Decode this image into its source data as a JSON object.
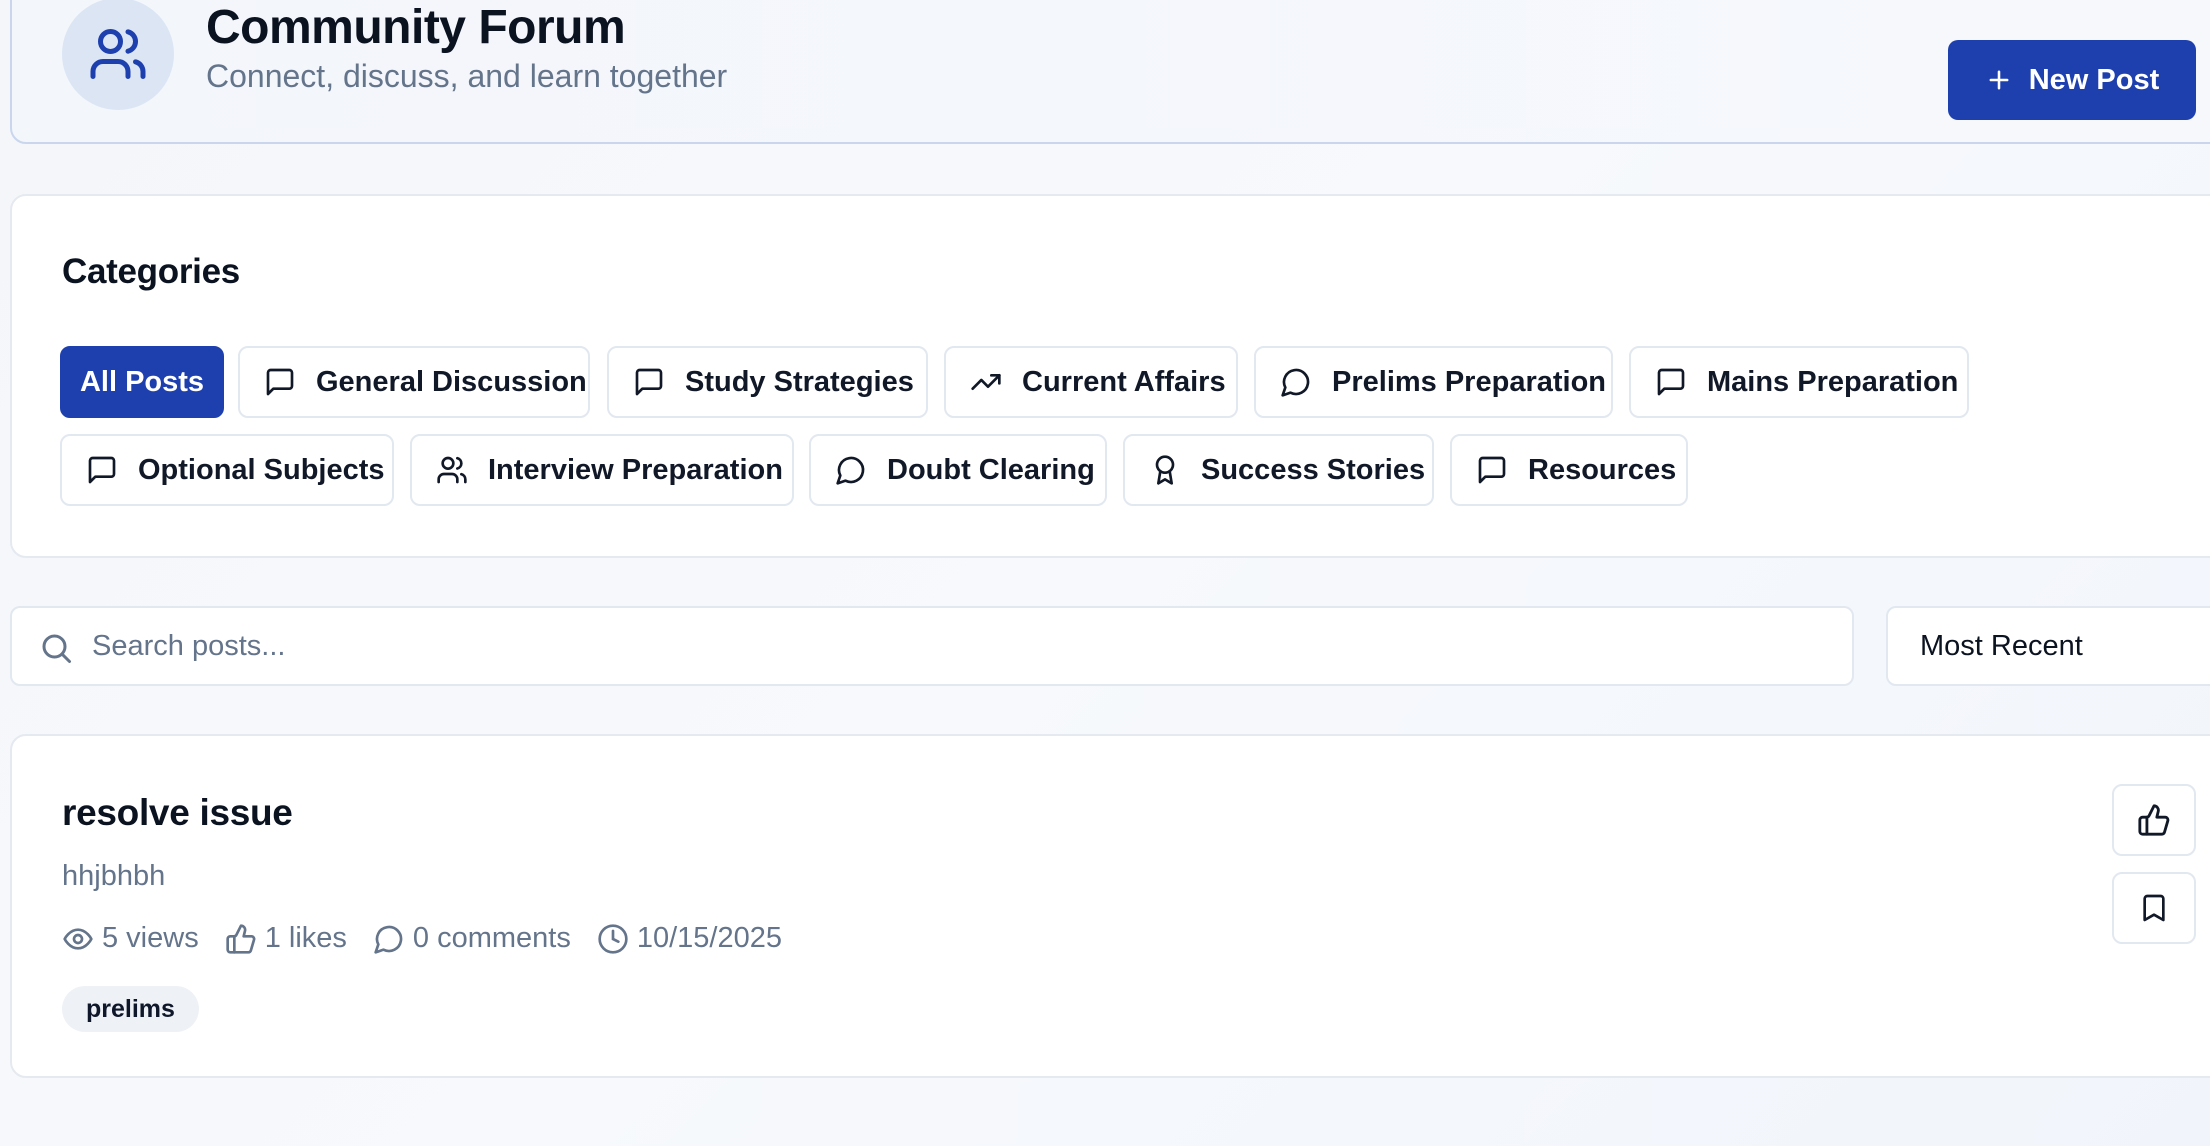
{
  "header": {
    "title": "Community Forum",
    "subtitle": "Connect, discuss, and learn together",
    "new_post_label": "New Post",
    "icon": "users-icon"
  },
  "categories": {
    "title": "Categories",
    "items": [
      {
        "label": "All Posts",
        "icon": "",
        "active": true
      },
      {
        "label": "General Discussion",
        "icon": "message-square-icon"
      },
      {
        "label": "Study Strategies",
        "icon": "message-square-icon"
      },
      {
        "label": "Current Affairs",
        "icon": "trending-up-icon"
      },
      {
        "label": "Prelims Preparation",
        "icon": "message-circle-icon"
      },
      {
        "label": "Mains Preparation",
        "icon": "message-square-icon"
      },
      {
        "label": "Optional Subjects",
        "icon": "message-square-icon"
      },
      {
        "label": "Interview Preparation",
        "icon": "users-icon"
      },
      {
        "label": "Doubt Clearing",
        "icon": "message-circle-icon"
      },
      {
        "label": "Success Stories",
        "icon": "award-icon"
      },
      {
        "label": "Resources",
        "icon": "message-square-icon"
      }
    ]
  },
  "search": {
    "placeholder": "Search posts...",
    "value": ""
  },
  "sort": {
    "selected": "Most Recent"
  },
  "posts": [
    {
      "title": "resolve issue",
      "excerpt": "hhjbhbh",
      "views": "5 views",
      "likes": "1 likes",
      "comments": "0 comments",
      "date": "10/15/2025",
      "tag": "prelims"
    }
  ],
  "colors": {
    "primary": "#1e40af",
    "muted_text": "#64748b",
    "border": "#e2e8f0"
  }
}
